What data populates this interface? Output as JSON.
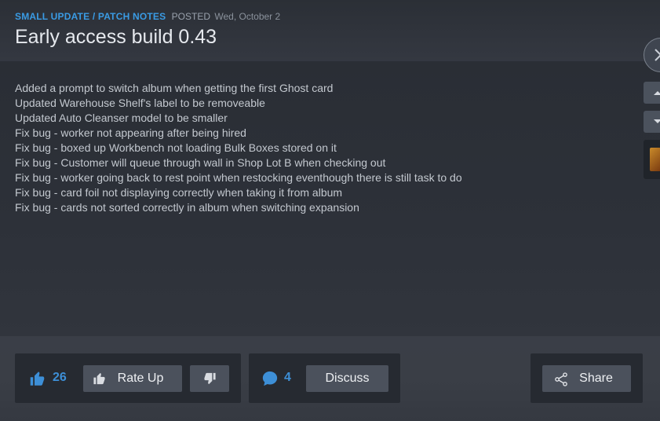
{
  "post": {
    "category": "SMALL UPDATE / PATCH NOTES",
    "posted_label": "POSTED",
    "date": "Wed, October 2",
    "title": "Early access build 0.43"
  },
  "notes": [
    "Added a prompt to switch album when getting the first Ghost card",
    "Updated Warehouse Shelf's label to be removeable",
    "Updated Auto Cleanser model to be smaller",
    "Fix bug - worker not appearing after being hired",
    "Fix bug - boxed up Workbench not loading Bulk Boxes stored on it",
    "Fix bug - Customer will queue through wall in Shop Lot B when checking out",
    "Fix bug - worker going back to rest point when restocking eventhough there is still task to do",
    "Fix bug - card foil not displaying correctly when taking it from album",
    "Fix bug - cards not sorted correctly in album when switching expansion"
  ],
  "actions": {
    "likes": "26",
    "rate_up_label": "Rate Up",
    "comments": "4",
    "discuss_label": "Discuss",
    "share_label": "Share"
  },
  "icons": {
    "like": "thumbs-up-icon",
    "rate_up": "thumbs-up-icon",
    "rate_down": "thumbs-down-icon",
    "comment": "speech-bubble-icon",
    "share": "share-icon",
    "close": "close-icon",
    "scroll_up": "chevron-up-icon",
    "scroll_down": "chevron-down-icon"
  },
  "colors": {
    "accent": "#3a9be4",
    "count": "#3d8fd7",
    "button": "#4b515c",
    "background": "#2f333b"
  }
}
